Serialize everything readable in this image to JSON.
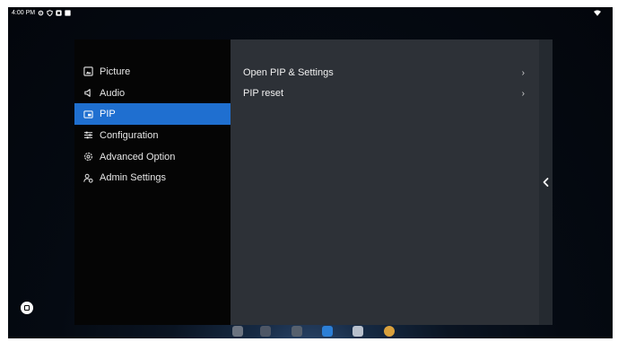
{
  "status_bar": {
    "time": "4:00 PM",
    "icons": [
      "settings-status-icon",
      "shield-status-icon",
      "download-status-icon",
      "square-status-icon",
      "wifi-icon"
    ]
  },
  "sidebar": {
    "items": [
      {
        "label": "Picture",
        "icon": "picture-icon"
      },
      {
        "label": "Audio",
        "icon": "audio-icon"
      },
      {
        "label": "PIP",
        "icon": "pip-icon",
        "active": true
      },
      {
        "label": "Configuration",
        "icon": "configuration-icon"
      },
      {
        "label": "Advanced Option",
        "icon": "advanced-option-icon"
      },
      {
        "label": "Admin Settings",
        "icon": "admin-settings-icon"
      }
    ]
  },
  "content": {
    "rows": [
      {
        "label": "Open PIP & Settings",
        "chevron": "›"
      },
      {
        "label": "PIP reset",
        "chevron": "›"
      }
    ]
  },
  "rail": {
    "collapse_glyph": "‹"
  },
  "dock": {
    "apps": [
      "camera-app-icon",
      "folder-app-icon",
      "settings-app-icon",
      "play-store-app-icon",
      "apps-grid-app-icon",
      "browser-app-icon"
    ]
  },
  "colors": {
    "accent": "#1f6fd0",
    "sidebar_bg": "#050505",
    "content_bg": "#2d3137",
    "rail_bg": "#252a30"
  }
}
